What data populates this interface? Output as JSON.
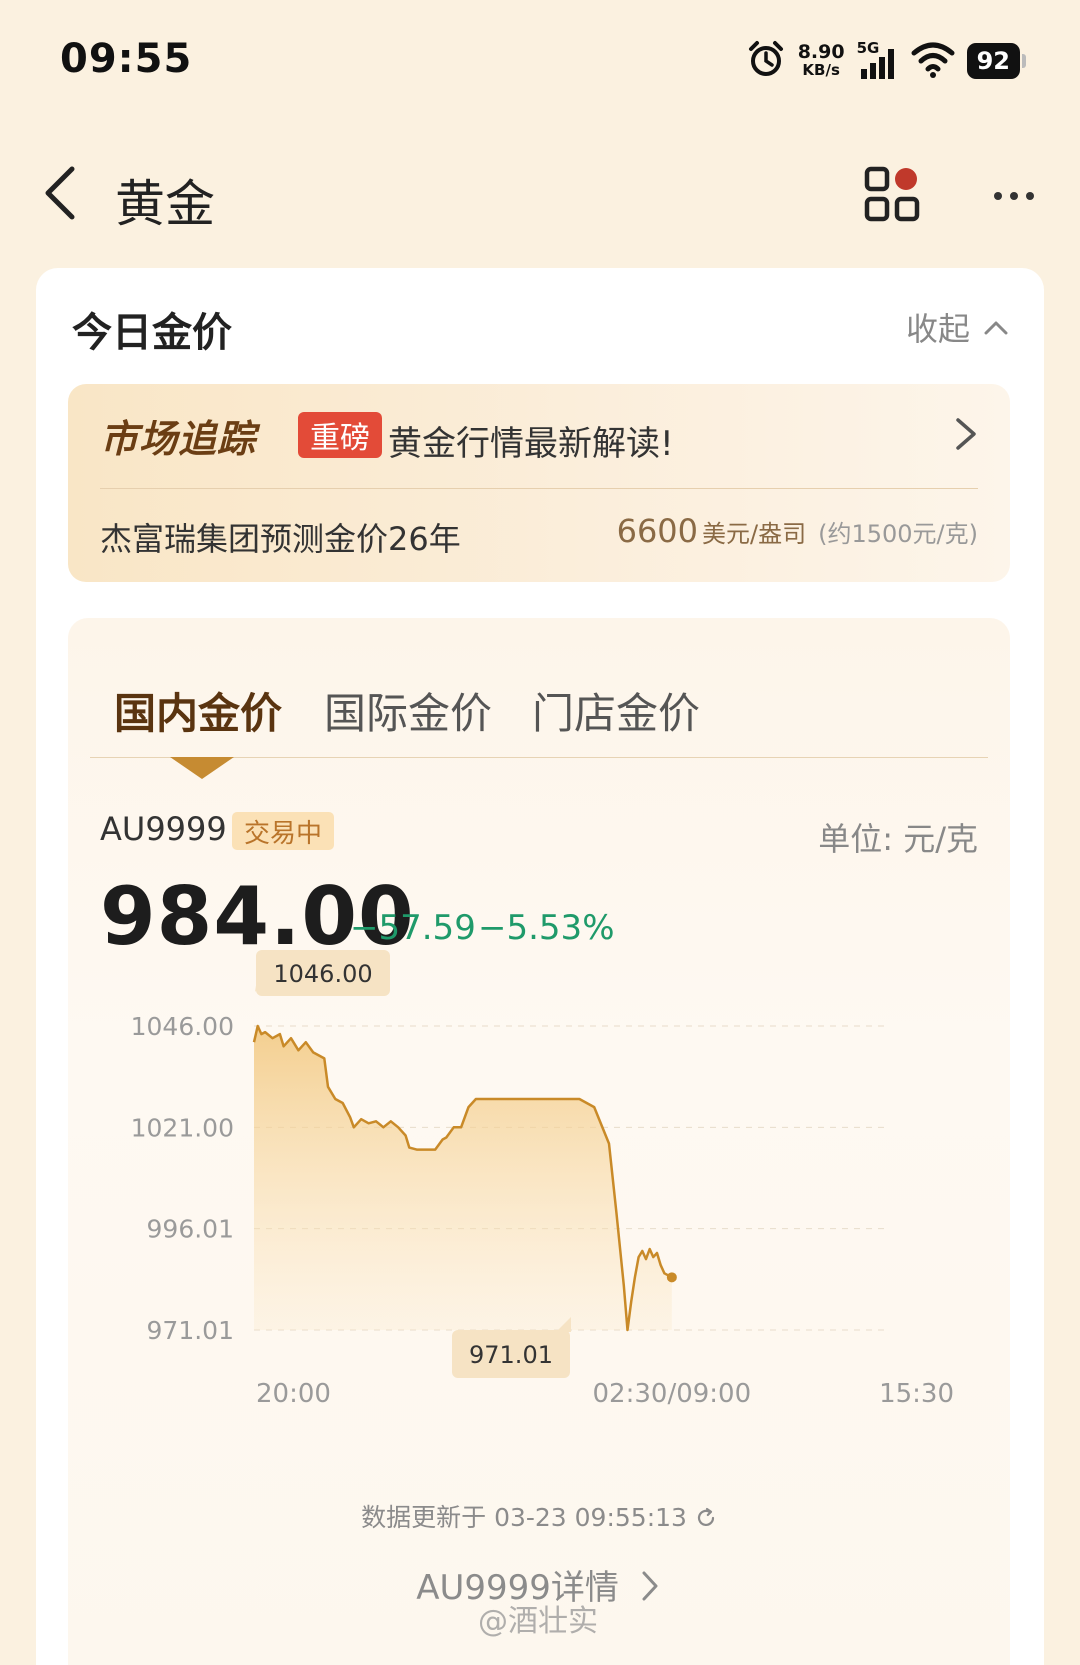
{
  "status_bar": {
    "time": "09:55",
    "speed_value": "8.90",
    "speed_unit": "KB/s",
    "network": "5G",
    "battery": "92",
    "icons": [
      "alarm-icon",
      "signal-icon",
      "wifi-icon",
      "battery-icon"
    ]
  },
  "nav": {
    "title": "黄金",
    "back_icon": "chevron-left-icon",
    "grid_icon": "apps-grid-icon",
    "more_icon": "more-dots-icon"
  },
  "today": {
    "title": "今日金价",
    "collapse_label": "收起"
  },
  "news": {
    "tag": "市场追踪",
    "badge": "重磅",
    "headline": "黄金行情最新解读!",
    "sub": "杰富瑞集团预测金价26年",
    "price": "6600",
    "price_unit": "美元/盎司",
    "approx": "(约1500元/克)"
  },
  "tabs": [
    "国内金价",
    "国际金价",
    "门店金价"
  ],
  "quote": {
    "symbol": "AU9999",
    "status": "交易中",
    "unit": "单位:  元/克",
    "price": "984.00",
    "change": "−57.59",
    "change_pct": "−5.53%"
  },
  "colors": {
    "accent": "#c68b32",
    "down": "#1f9a6a",
    "news_badge": "#e34b38",
    "background": "#fbf1e0"
  },
  "chart_data": {
    "type": "area",
    "y_ticks": [
      "1046.00",
      "1021.00",
      "996.01",
      "971.01"
    ],
    "x_ticks": [
      "20:00",
      "02:30/09:00",
      "15:30"
    ],
    "ylim": [
      971.01,
      1046.0
    ],
    "max_label": "1046.00",
    "min_label": "971.01",
    "series": [
      {
        "x": [
          0,
          1,
          2,
          3,
          5,
          7,
          8,
          10,
          12,
          14,
          16,
          17,
          19,
          20,
          22,
          24,
          26,
          27,
          29,
          31,
          33,
          35,
          37,
          39,
          41,
          42,
          44,
          46,
          47,
          49,
          51,
          52,
          54,
          56,
          58,
          60,
          62,
          66,
          70,
          73,
          77,
          80,
          84,
          88,
          92,
          96,
          98,
          100,
          101,
          102,
          103,
          104,
          105,
          106,
          107,
          108,
          109,
          110,
          111,
          112,
          113
        ],
        "y": [
          1042.0,
          1046.0,
          1044.0,
          1044.5,
          1043.0,
          1044.0,
          1041.0,
          1043.0,
          1040.0,
          1042.0,
          1039.5,
          1039.0,
          1038.0,
          1031.0,
          1028.0,
          1027.0,
          1023.5,
          1021.0,
          1023.0,
          1022.0,
          1022.5,
          1021.0,
          1022.5,
          1021.0,
          1019.0,
          1016.0,
          1015.5,
          1015.5,
          1015.5,
          1015.5,
          1018.0,
          1018.5,
          1021.0,
          1021.0,
          1026.0,
          1028.0,
          1028.0,
          1028.0,
          1028.0,
          1028.0,
          1028.0,
          1028.0,
          1028.0,
          1028.0,
          1026.0,
          1017.0,
          1000.0,
          982.0,
          971.01,
          978.0,
          984.0,
          989.0,
          990.5,
          988.5,
          991.0,
          989.0,
          990.0,
          987.0,
          985.0,
          984.5,
          984.0
        ]
      }
    ],
    "grid": true
  },
  "footer": {
    "update_prefix": "数据更新于",
    "update_time": "03-23 09:55:13",
    "refresh_icon": "refresh-icon",
    "details_label": "AU9999详情"
  },
  "watermark": "@酒壮实"
}
